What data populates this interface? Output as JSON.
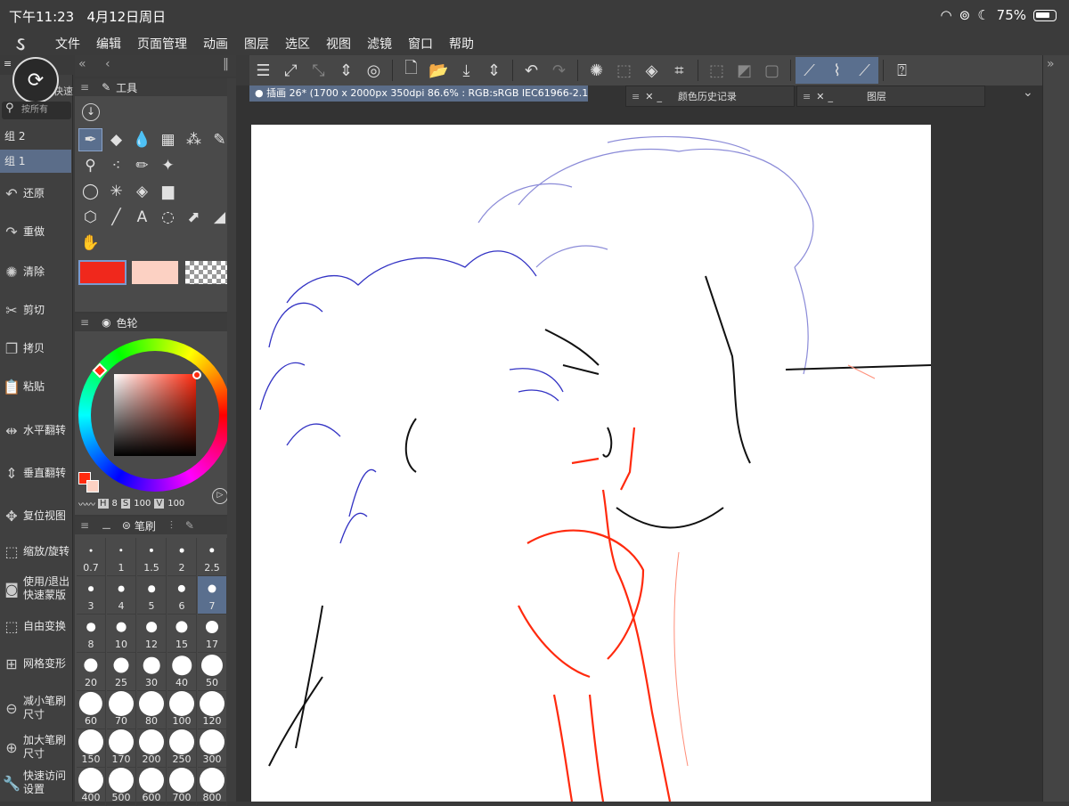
{
  "status": {
    "time": "下午11:23",
    "date": "4月12日周日",
    "battery": "75%"
  },
  "menu": {
    "items": [
      "文件",
      "编辑",
      "页面管理",
      "动画",
      "图层",
      "选区",
      "视图",
      "滤镜",
      "窗口",
      "帮助"
    ]
  },
  "left": {
    "search_placeholder": "按所有",
    "tab_label": "快速",
    "groups": [
      "组 2",
      "组 1"
    ],
    "commands": [
      {
        "icon": "undo-icon",
        "glyph": "↶",
        "label": "还原"
      },
      {
        "icon": "redo-icon",
        "glyph": "↷",
        "label": "重做"
      },
      {
        "icon": "clear-icon",
        "glyph": "✺",
        "label": "清除"
      },
      {
        "icon": "scissors-icon",
        "glyph": "✂",
        "label": "剪切"
      },
      {
        "icon": "copy-icon",
        "glyph": "❐",
        "label": "拷贝"
      },
      {
        "icon": "paste-icon",
        "glyph": "📋",
        "label": "粘贴"
      },
      {
        "icon": "flip-horizontal-icon",
        "glyph": "⇹",
        "label": "水平翻转"
      },
      {
        "icon": "flip-vertical-icon",
        "glyph": "⇕",
        "label": "垂直翻转"
      },
      {
        "icon": "reset-view-icon",
        "glyph": "✥",
        "label": "复位视图"
      },
      {
        "icon": "zoom-rotate-icon",
        "glyph": "⬚",
        "label": "缩放/旋转"
      },
      {
        "icon": "quick-mask-icon",
        "glyph": "◙",
        "label": "使用/退出快速蒙版"
      },
      {
        "icon": "free-transform-icon",
        "glyph": "⬚",
        "label": "自由变换"
      },
      {
        "icon": "mesh-transform-icon",
        "glyph": "⊞",
        "label": "网格变形"
      },
      {
        "icon": "decrease-brush-icon",
        "glyph": "⊖",
        "label": "减小笔刷尺寸"
      },
      {
        "icon": "increase-brush-icon",
        "glyph": "⊕",
        "label": "加大笔刷尺寸"
      },
      {
        "icon": "wrench-icon",
        "glyph": "🔧",
        "label": "快速访问设置"
      }
    ]
  },
  "tools": {
    "title": "工具",
    "items": [
      {
        "icon": "pen-icon",
        "glyph": "✒",
        "sel": true
      },
      {
        "icon": "eraser-icon",
        "glyph": "◆"
      },
      {
        "icon": "blend-icon",
        "glyph": "💧"
      },
      {
        "icon": "frame-icon",
        "glyph": "▦"
      },
      {
        "icon": "spray-icon",
        "glyph": "⁂"
      },
      {
        "icon": "fill-pen-icon",
        "glyph": "✎"
      },
      {
        "icon": "eyedropper-icon",
        "glyph": "⚲"
      },
      {
        "icon": "stamp-icon",
        "glyph": "⁖"
      },
      {
        "icon": "pencil-icon",
        "glyph": "✏"
      },
      {
        "icon": "sparkle-icon",
        "glyph": "✦"
      },
      {
        "icon": "blank-icon",
        "glyph": ""
      },
      {
        "icon": "blank-icon",
        "glyph": ""
      },
      {
        "icon": "lasso-icon",
        "glyph": "◯"
      },
      {
        "icon": "magic-wand-icon",
        "glyph": "✳"
      },
      {
        "icon": "bucket-icon",
        "glyph": "◈"
      },
      {
        "icon": "gradient-icon",
        "glyph": "▆"
      },
      {
        "icon": "blank-icon",
        "glyph": ""
      },
      {
        "icon": "blank-icon",
        "glyph": ""
      },
      {
        "icon": "3d-object-icon",
        "glyph": "⬡"
      },
      {
        "icon": "line-icon",
        "glyph": "╱"
      },
      {
        "icon": "text-icon",
        "glyph": "A"
      },
      {
        "icon": "balloon-icon",
        "glyph": "◌"
      },
      {
        "icon": "operation-icon",
        "glyph": "⬈"
      },
      {
        "icon": "ruler-icon",
        "glyph": "◢"
      },
      {
        "icon": "hand-icon",
        "glyph": "✋"
      }
    ],
    "main_color": "#f0281c",
    "sub_color": "#fcd1c3"
  },
  "colorwheel": {
    "title": "色轮",
    "h_label": "H",
    "h_value": "8",
    "s_label": "S",
    "s_value": "100",
    "v_label": "V",
    "v_value": "100"
  },
  "brush": {
    "title": "笔刷",
    "sizes": [
      "0.7",
      "1",
      "1.5",
      "2",
      "2.5",
      "3",
      "4",
      "5",
      "6",
      "7",
      "8",
      "10",
      "12",
      "15",
      "17",
      "20",
      "25",
      "30",
      "40",
      "50",
      "60",
      "70",
      "80",
      "100",
      "120",
      "150",
      "170",
      "200",
      "250",
      "300",
      "400",
      "500",
      "600",
      "700",
      "800"
    ],
    "selected": "7"
  },
  "doc": {
    "tab": "插画 26* (1700 x 2000px 350dpi 86.6% : RGB:sRGB IEC61966-2.1)",
    "color_history": "颜色历史记录",
    "layers": "图层"
  }
}
